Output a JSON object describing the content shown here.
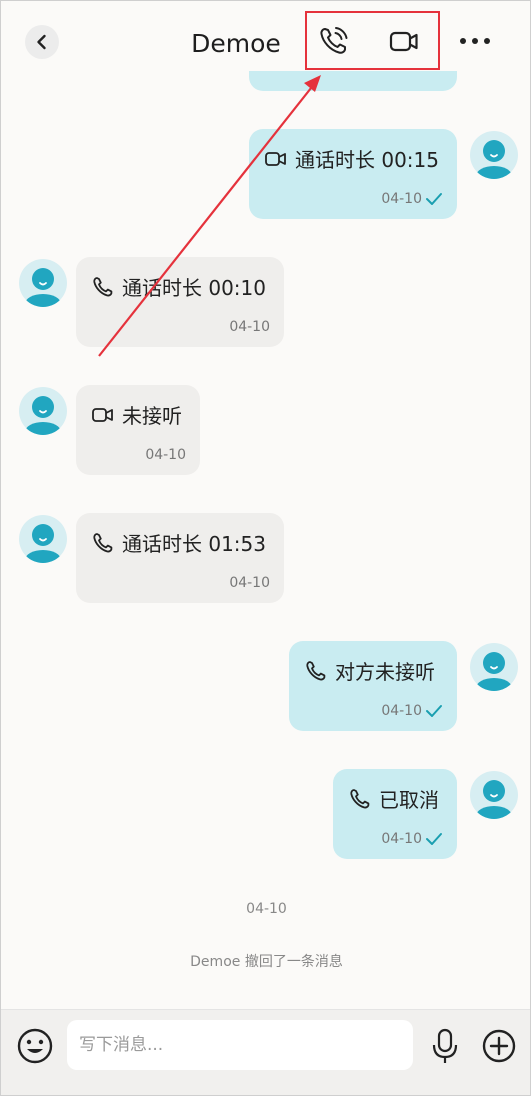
{
  "header": {
    "title": "Demoe",
    "icons": {
      "back": "chevron-left-icon",
      "voice_call": "phone-call-icon",
      "video_call": "video-camera-icon",
      "more": "more-dots-icon"
    },
    "highlight_color": "#e5323c"
  },
  "messages": [
    {
      "side": "out",
      "icon": "video-camera-icon",
      "text": "通话时长 00:15",
      "date": "04-10",
      "read": true
    },
    {
      "side": "in",
      "icon": "phone-icon",
      "text": "通话时长 00:10",
      "date": "04-10"
    },
    {
      "side": "in",
      "icon": "video-camera-icon",
      "text": "未接听",
      "date": "04-10"
    },
    {
      "side": "in",
      "icon": "phone-icon",
      "text": "通话时长 01:53",
      "date": "04-10"
    },
    {
      "side": "out",
      "icon": "phone-icon",
      "text": "对方未接听",
      "date": "04-10",
      "read": true
    },
    {
      "side": "out",
      "icon": "phone-icon",
      "text": "已取消",
      "date": "04-10",
      "read": true
    }
  ],
  "system": {
    "date": "04-10",
    "notice": "Demoe 撤回了一条消息"
  },
  "input": {
    "placeholder": "写下消息..."
  },
  "colors": {
    "outgoing_bubble": "#c9ecf1",
    "incoming_bubble": "#efeeec",
    "read_check": "#1a9fb0",
    "avatar": "#21a6c0"
  }
}
